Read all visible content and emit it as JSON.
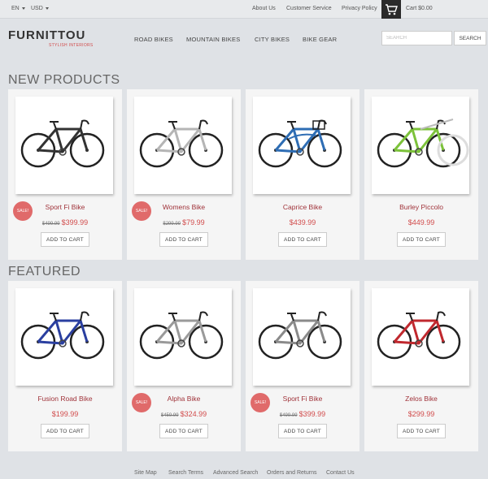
{
  "topbar": {
    "language": "EN",
    "currency": "USD",
    "links": [
      "About Us",
      "Customer Service",
      "Privacy Policy"
    ],
    "cart_label": "Cart $0.00"
  },
  "header": {
    "logo_title": "FURNITTOU",
    "logo_subtitle": "STYLISH INTERIORS",
    "nav": [
      "ROAD BIKES",
      "MOUNTAIN BIKES",
      "CITY BIKES",
      "BIKE GEAR"
    ],
    "search_placeholder": "SEARCH",
    "search_button": "SEARCH"
  },
  "sections": {
    "new_title": "NEW PRODUCTS",
    "featured_title": "FEATURED"
  },
  "new_products": [
    {
      "name": "Sport Fi Bike",
      "old_price": "$499.99",
      "price": "$399.99",
      "sale": "SALE!",
      "add_to_cart": "ADD TO CART",
      "icon": "road-bike-black",
      "color": "#333333"
    },
    {
      "name": "Womens Bike",
      "old_price": "$299.99",
      "price": "$79.99",
      "sale": "SALE!",
      "add_to_cart": "ADD TO CART",
      "icon": "hybrid-bike-silver",
      "color": "#b5b5b5"
    },
    {
      "name": "Caprice Bike",
      "old_price": "",
      "price": "$439.99",
      "sale": "",
      "add_to_cart": "ADD TO CART",
      "icon": "city-bike-blue",
      "color": "#2e6db4"
    },
    {
      "name": "Burley Piccolo",
      "old_price": "",
      "price": "$449.99",
      "sale": "",
      "add_to_cart": "ADD TO CART",
      "icon": "trailer-bike-green",
      "color": "#7cc23a"
    }
  ],
  "featured": [
    {
      "name": "Fusion Road Bike",
      "old_price": "",
      "price": "$199.99",
      "sale": "",
      "add_to_cart": "ADD TO CART",
      "icon": "road-bike-blue",
      "color": "#2a3fa0"
    },
    {
      "name": "Alpha Bike",
      "old_price": "$459.99",
      "price": "$324.99",
      "sale": "SALE!",
      "add_to_cart": "ADD TO CART",
      "icon": "road-bike-white",
      "color": "#e8e8e8"
    },
    {
      "name": "Sport Fi Bike",
      "old_price": "$499.99",
      "price": "$399.99",
      "sale": "SALE!",
      "add_to_cart": "ADD TO CART",
      "icon": "road-bike-grey",
      "color": "#8a8a8a"
    },
    {
      "name": "Zelos Bike",
      "old_price": "",
      "price": "$299.99",
      "sale": "",
      "add_to_cart": "ADD TO CART",
      "icon": "road-bike-red",
      "color": "#c0282e"
    }
  ],
  "footer": {
    "links": [
      "Site Map",
      "Search Terms",
      "Advanced Search",
      "Orders and Returns",
      "Contact Us"
    ]
  }
}
